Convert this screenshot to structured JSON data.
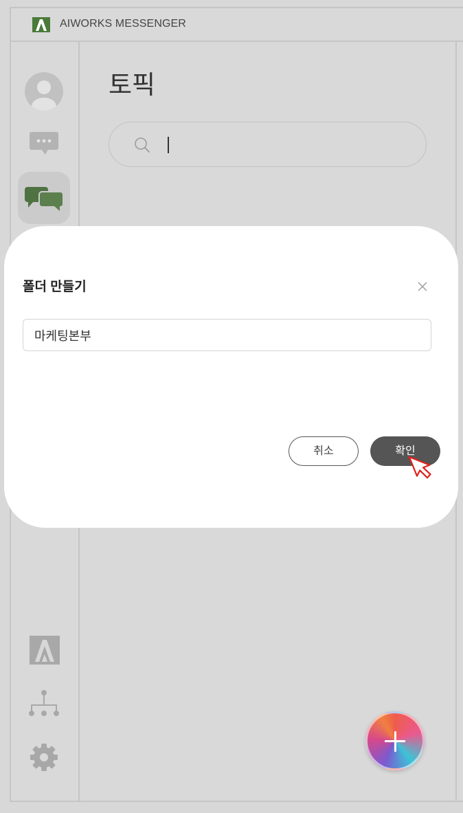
{
  "app": {
    "title": "AIWORKS MESSENGER",
    "logo_icon": "aiworks-logo-icon"
  },
  "sidebar": {
    "items": [
      {
        "icon": "profile-avatar-icon"
      },
      {
        "icon": "chat-icon"
      },
      {
        "icon": "topic-icon",
        "active": true
      }
    ],
    "bottom_items": [
      {
        "icon": "aiworks-logo-icon"
      },
      {
        "icon": "org-chart-icon"
      },
      {
        "icon": "settings-gear-icon"
      }
    ]
  },
  "main": {
    "title": "토픽",
    "search": {
      "icon": "search-icon",
      "value": ""
    }
  },
  "fab": {
    "icon": "plus-icon"
  },
  "modal": {
    "title": "폴더 만들기",
    "close_icon": "close-icon",
    "folder_name": "마케팅본부",
    "cancel_label": "취소",
    "confirm_label": "확인"
  },
  "colors": {
    "brand_green": "#4a7a3a",
    "confirm_button": "#555555",
    "dim_background": "#d9d9d9"
  }
}
